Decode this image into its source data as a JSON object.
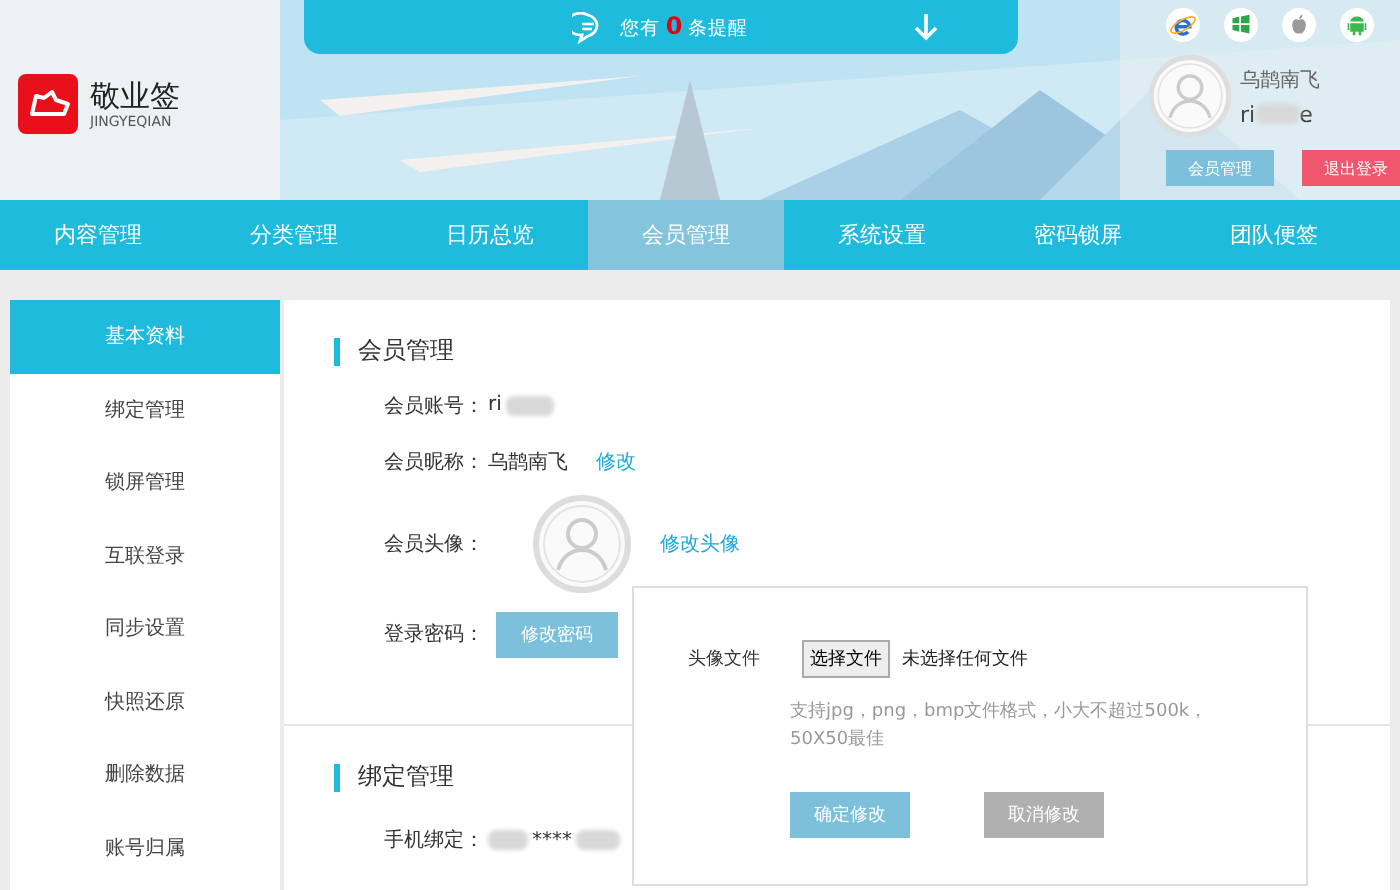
{
  "notice": {
    "prefix": "您有",
    "count": "0",
    "suffix": "条提醒"
  },
  "logo": {
    "name": "敬业签",
    "sub": "JINGYEQIAN"
  },
  "platforms": [
    {
      "kind": "ie"
    },
    {
      "kind": "windows"
    },
    {
      "kind": "apple"
    },
    {
      "kind": "android"
    }
  ],
  "user": {
    "nickname": "乌鹊南飞",
    "account_start": "ri",
    "account_end": "e",
    "buttons": [
      {
        "label": "会员管理",
        "kind": "primary"
      },
      {
        "label": "退出登录",
        "kind": "danger"
      }
    ]
  },
  "nav": [
    {
      "label": "内容管理",
      "selected": false
    },
    {
      "label": "分类管理",
      "selected": false
    },
    {
      "label": "日历总览",
      "selected": false
    },
    {
      "label": "会员管理",
      "selected": true
    },
    {
      "label": "系统设置",
      "selected": false
    },
    {
      "label": "密码锁屏",
      "selected": false
    },
    {
      "label": "团队便签",
      "selected": false
    }
  ],
  "sidebar": [
    {
      "label": "基本资料",
      "selected": true
    },
    {
      "label": "绑定管理",
      "selected": false
    },
    {
      "label": "锁屏管理",
      "selected": false
    },
    {
      "label": "互联登录",
      "selected": false
    },
    {
      "label": "同步设置",
      "selected": false
    },
    {
      "label": "快照还原",
      "selected": false
    },
    {
      "label": "删除数据",
      "selected": false
    },
    {
      "label": "账号归属",
      "selected": false
    }
  ],
  "member": {
    "title": "会员管理",
    "account_label": "会员账号：",
    "account_start": "ri",
    "nickname_label": "会员昵称：",
    "nickname": "乌鹊南飞",
    "edit_link": "修改",
    "avatar_label": "会员头像：",
    "avatar_link": "修改头像",
    "password_label": "登录密码：",
    "password_button": "修改密码"
  },
  "binding": {
    "title": "绑定管理",
    "phone_label": "手机绑定：",
    "phone_mask": "****"
  },
  "avatar_popup": {
    "file_label": "头像文件",
    "choose_button": "选择文件",
    "no_file": "未选择任何文件",
    "hint": "支持jpg，png，bmp文件格式，小大不超过500k，50X50最佳",
    "confirm": "确定修改",
    "cancel": "取消修改"
  }
}
